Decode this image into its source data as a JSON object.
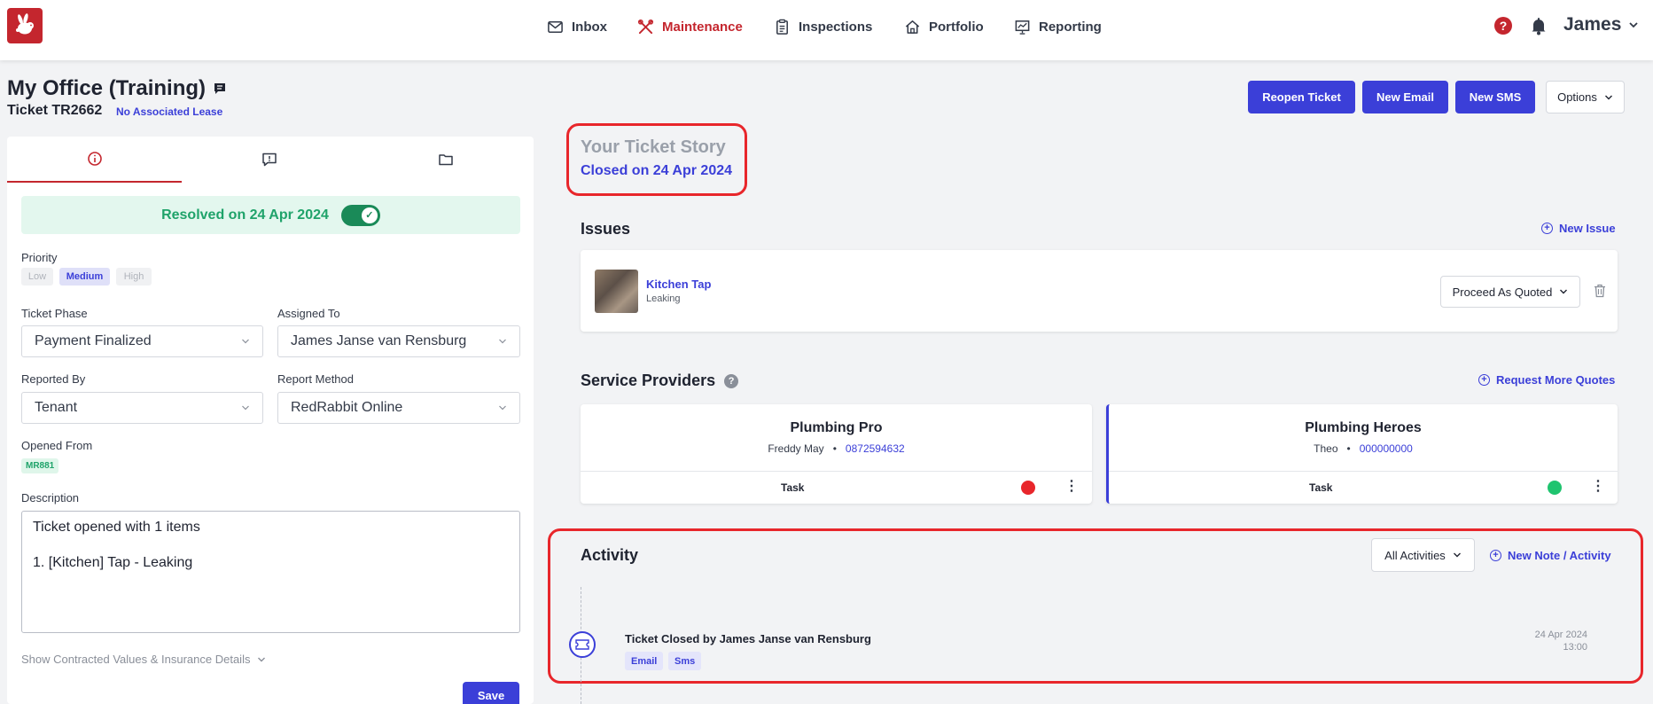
{
  "nav": {
    "items": [
      {
        "label": "Inbox",
        "icon": "envelope-icon"
      },
      {
        "label": "Maintenance",
        "icon": "tools-icon"
      },
      {
        "label": "Inspections",
        "icon": "clipboard-icon"
      },
      {
        "label": "Portfolio",
        "icon": "home-icon"
      },
      {
        "label": "Reporting",
        "icon": "chart-board-icon"
      }
    ],
    "active": "Maintenance",
    "user": "James",
    "help": "?"
  },
  "header": {
    "title": "My Office (Training)",
    "ticket_id": "Ticket TR2662",
    "lease_link": "No Associated Lease",
    "buttons": {
      "reopen": "Reopen Ticket",
      "new_email": "New Email",
      "new_sms": "New SMS",
      "options": "Options"
    }
  },
  "details": {
    "resolved_text": "Resolved on 24 Apr 2024",
    "priority_label": "Priority",
    "priority_options": [
      "Low",
      "Medium",
      "High"
    ],
    "priority_selected": "Medium",
    "ticket_phase_label": "Ticket Phase",
    "ticket_phase_value": "Payment Finalized",
    "assigned_to_label": "Assigned To",
    "assigned_to_value": "James Janse van Rensburg",
    "reported_by_label": "Reported By",
    "reported_by_value": "Tenant",
    "report_method_label": "Report Method",
    "report_method_value": "RedRabbit Online",
    "opened_from_label": "Opened From",
    "opened_from_value": "MR881",
    "description_label": "Description",
    "description_line1": "Ticket opened with 1 items",
    "description_line2": "1. [Kitchen] Tap - Leaking",
    "contracted_link": "Show Contracted Values & Insurance Details",
    "save": "Save"
  },
  "story": {
    "title": "Your Ticket Story",
    "subtitle": "Closed on 24 Apr 2024"
  },
  "issues": {
    "title": "Issues",
    "new_issue": "New Issue",
    "items": [
      {
        "name": "Kitchen Tap",
        "status": "Leaking",
        "action": "Proceed As Quoted"
      }
    ]
  },
  "service_providers": {
    "title": "Service Providers",
    "request_quotes": "Request More Quotes",
    "providers": [
      {
        "name": "Plumbing Pro",
        "contact": "Freddy May",
        "phone": "0872594632",
        "task": "Task",
        "status_color": "#e8262b"
      },
      {
        "name": "Plumbing Heroes",
        "contact": "Theo",
        "phone": "000000000",
        "task": "Task",
        "status_color": "#1fc46f"
      }
    ]
  },
  "activity": {
    "title": "Activity",
    "filter": "All Activities",
    "new_note": "New Note / Activity",
    "entries": [
      {
        "text": "Ticket Closed by James Janse van Rensburg",
        "tags": [
          "Email",
          "Sms"
        ],
        "date": "24 Apr 2024",
        "time": "13:00"
      }
    ]
  },
  "colors": {
    "brand_red": "#c4262e",
    "primary_blue": "#3b3fd8",
    "success_green": "#1fa36a",
    "highlight_red": "#e8262b"
  }
}
